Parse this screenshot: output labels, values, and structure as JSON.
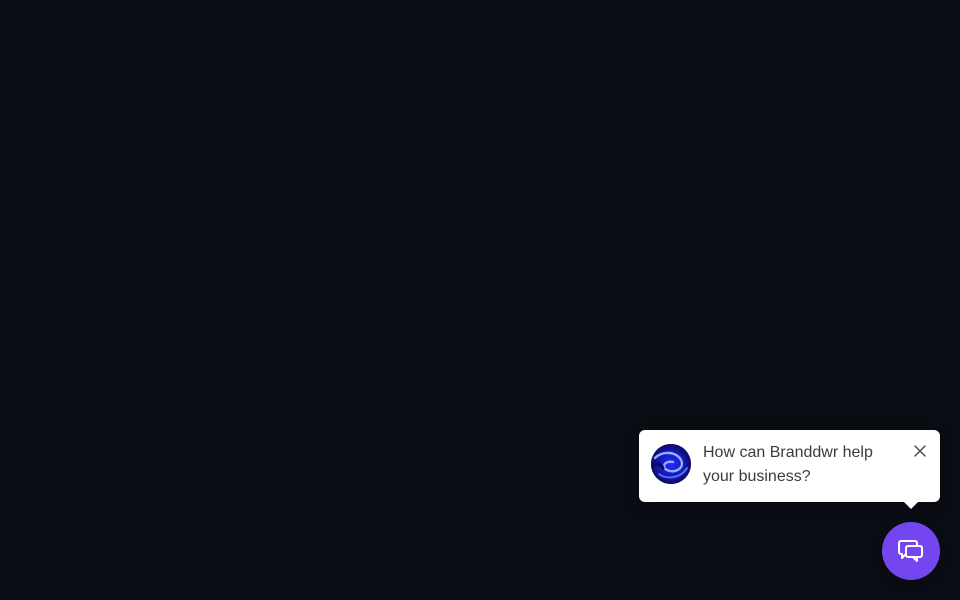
{
  "chat_popup": {
    "message": "How can Branddwr help your business?",
    "avatar_icon": "swirl-logo-icon",
    "close_icon": "close-icon",
    "background": "#ffffff",
    "text_color": "#3a3a44"
  },
  "chat_launcher": {
    "icon": "chat-bubbles-icon",
    "color": "#7446ef"
  },
  "page": {
    "background": "#0b0d14"
  }
}
